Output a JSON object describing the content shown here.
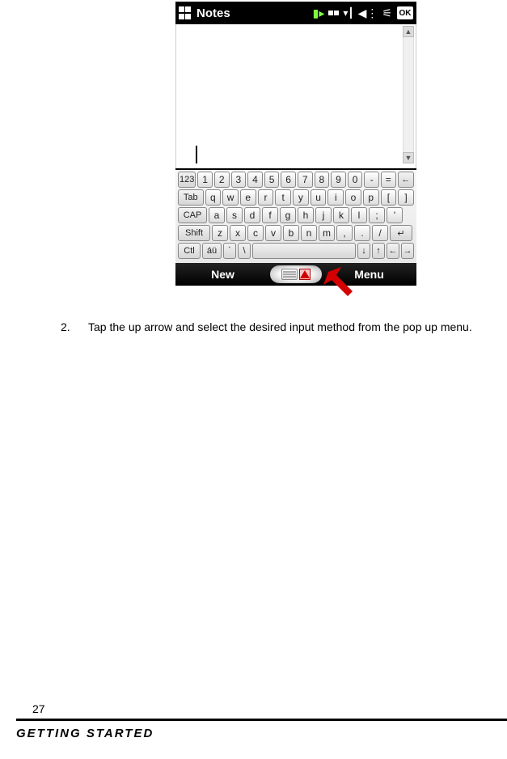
{
  "titlebar": {
    "app_name": "Notes",
    "ok": "OK"
  },
  "kbd": {
    "row1": [
      "1",
      "2",
      "3",
      "4",
      "5",
      "6",
      "7",
      "8",
      "9",
      "0",
      "-",
      "="
    ],
    "row2": [
      "q",
      "w",
      "e",
      "r",
      "t",
      "y",
      "u",
      "i",
      "o",
      "p",
      "[",
      "]"
    ],
    "row3": [
      "a",
      "s",
      "d",
      "f",
      "g",
      "h",
      "j",
      "k",
      "l",
      ";",
      "'"
    ],
    "row4": [
      "z",
      "x",
      "c",
      "v",
      "b",
      "n",
      "m",
      ",",
      ".",
      "/"
    ],
    "label_123": "123",
    "label_tab": "Tab",
    "label_cap": "CAP",
    "label_shift": "Shift",
    "label_ctl": "Ctl",
    "label_au": "áü",
    "label_bksp": "←",
    "label_enter": "↵",
    "label_grave": "`",
    "label_bslash": "\\",
    "label_down": "↓",
    "label_up": "↑",
    "label_left": "←",
    "label_right": "→"
  },
  "softkeys": {
    "left": "New",
    "right": "Menu"
  },
  "instruction": {
    "number": "2.",
    "text": "Tap the up arrow and select the desired input method from the pop up menu."
  },
  "footer": {
    "page": "27",
    "section": "GETTING STARTED"
  }
}
